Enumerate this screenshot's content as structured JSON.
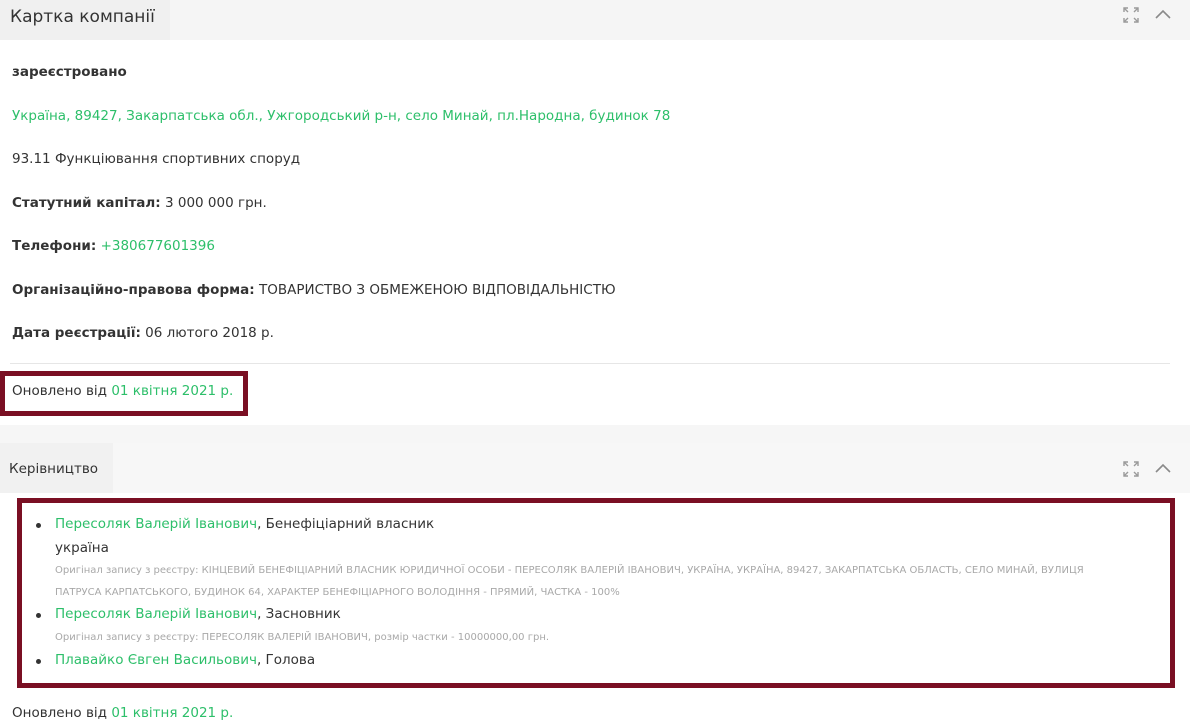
{
  "company_card": {
    "title": "Картка компанії",
    "status": "зареєстровано",
    "address": "Україна, 89427, Закарпатська обл., Ужгородський р-н, село Минай, пл.Народна, будинок 78",
    "activity": "93.11 Функціювання спортивних споруд",
    "capital_label": "Статутний капітал:",
    "capital_value": "3 000 000 грн.",
    "phones_label": "Телефони:",
    "phone": "+380677601396",
    "legal_form_label": "Організаційно-правова форма:",
    "legal_form_value": "ТОВАРИСТВО З ОБМЕЖЕНОЮ ВІДПОВІДАЛЬНІСТЮ",
    "reg_date_label": "Дата реєстрації:",
    "reg_date_value": "06 лютого 2018 р.",
    "updated_prefix": "Оновлено від",
    "updated_date": "01 квітня 2021 р."
  },
  "management": {
    "title": "Керівництво",
    "people": [
      {
        "name": "Пересоляк Валерій Іванович",
        "role": ", Бенефіціарний власник",
        "country": "україна",
        "original_line1": "Оригінал запису з реєстру: КІНЦЕВИЙ БЕНЕФІЦІАРНИЙ ВЛАСНИК ЮРИДИЧНОЇ ОСОБИ - ПЕРЕСОЛЯК ВАЛЕРІЙ ІВАНОВИЧ, УКРАЇНА, УКРАЇНА, 89427, ЗАКАРПАТСЬКА ОБЛАСТЬ, СЕЛО МИНАЙ, ВУЛИЦЯ",
        "original_line2": "ПАТРУСА КАРПАТСЬКОГО, БУДИНОК 64, ХАРАКТЕР БЕНЕФІЦІАРНОГО ВОЛОДІННЯ - ПРЯМИЙ, ЧАСТКА - 100%"
      },
      {
        "name": "Пересоляк Валерій Іванович",
        "role": ", Засновник",
        "original_line1": "Оригінал запису з реєстру: ПЕРЕСОЛЯК ВАЛЕРІЙ ІВАНОВИЧ, розмір частки - 10000000,00 грн."
      },
      {
        "name": "Плавайко Євген Васильович",
        "role": ", Голова"
      }
    ],
    "updated_prefix": "Оновлено від",
    "updated_date": "01 квітня 2021 р."
  },
  "colors": {
    "accent_green": "#2dbf6a",
    "highlight_border": "#7a0f23"
  },
  "icons": {
    "expand": "expand-icon",
    "collapse": "chevron-up-icon"
  }
}
